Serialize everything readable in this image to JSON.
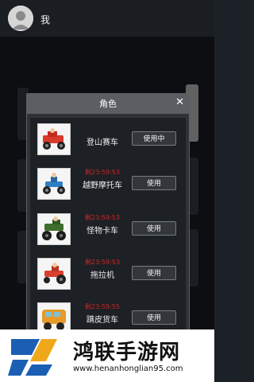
{
  "topbar": {
    "me_label": "我"
  },
  "dialog": {
    "title": "角色",
    "close_glyph": "✕",
    "items": [
      {
        "name": "登山赛车",
        "timer": "",
        "button": "使用中"
      },
      {
        "name": "越野摩托车",
        "timer": "剩23:59:53",
        "button": "使用"
      },
      {
        "name": "怪物卡车",
        "timer": "剩23:59:53",
        "button": "使用"
      },
      {
        "name": "拖拉机",
        "timer": "剩23:59:53",
        "button": "使用"
      },
      {
        "name": "蹒皮货车",
        "timer": "剩23:59:55",
        "button": "使用"
      }
    ]
  },
  "watermark": {
    "title": "鸿联手游网",
    "url": "www.henanhonglian95.com"
  },
  "colors": {
    "timer": "#c52b2b",
    "dialog_header": "#5b5f63",
    "dialog_body": "#1d2024"
  }
}
